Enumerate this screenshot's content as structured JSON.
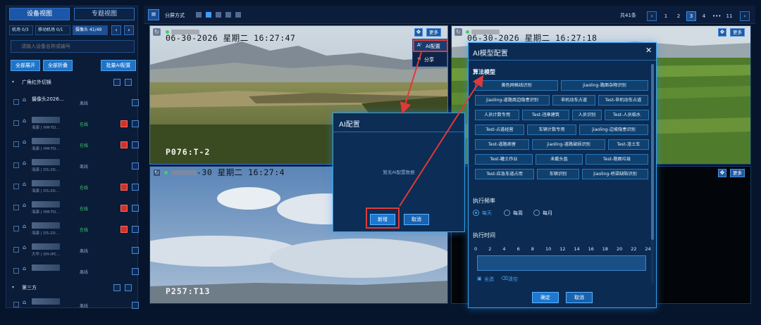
{
  "sidebar": {
    "tabs": [
      "设备视图",
      "专题视图"
    ],
    "stats": [
      "机场 0/3",
      "移动机场 0/1",
      "摄像头 41/49"
    ],
    "nav": [
      "‹",
      "›"
    ],
    "search_placeholder": "请输入设备名称或编号",
    "expand_all": "全部展开",
    "collapse_all": "全部折叠",
    "batch_ai": "批量AI配置",
    "group1": "广角红外切换",
    "group2": "第三方",
    "devices": [
      {
        "name": "摄像头2026...",
        "sub": "",
        "status": "离线",
        "online": false,
        "rec": false
      },
      {
        "name": "",
        "sub": "海康 | HM-TD...",
        "status": "在线",
        "online": true,
        "rec": true
      },
      {
        "name": "",
        "sub": "海康 | HM-TD...",
        "status": "在线",
        "online": true,
        "rec": true
      },
      {
        "name": "",
        "sub": "海康 | DS-2D...",
        "status": "离线",
        "online": false,
        "rec": false
      },
      {
        "name": "",
        "sub": "海康 | DS-2D...",
        "status": "在线",
        "online": true,
        "rec": true
      },
      {
        "name": "",
        "sub": "海康 | HM-TD...",
        "status": "在线",
        "online": true,
        "rec": true
      },
      {
        "name": "",
        "sub": "海康 | DS-2D...",
        "status": "在线",
        "online": true,
        "rec": true
      },
      {
        "name": "",
        "sub": "大华 | DH-IPC...",
        "status": "离线",
        "online": false,
        "rec": false
      },
      {
        "name": "",
        "sub": "",
        "status": "离线",
        "online": false,
        "rec": false
      }
    ],
    "device_bottom": {
      "name": "",
      "sub": "",
      "status": "离线"
    }
  },
  "topbar": {
    "split_label": "分屏方式",
    "total": "共41条",
    "pages": [
      "1",
      "2",
      "3",
      "4",
      "•••",
      "11"
    ],
    "current_page": "3"
  },
  "panes": [
    {
      "time": "06-30-2026 星期二 16:27:47",
      "name": "P076:T-2",
      "more": "更多"
    },
    {
      "time": "06-30-2026 星期二 16:27:18",
      "name": "",
      "more": "更多"
    },
    {
      "time": "-30 星期二 16:27:4",
      "name": "P257:T13",
      "more": ""
    },
    {
      "time": "",
      "name": "",
      "more": "更多"
    }
  ],
  "menu": {
    "ai": "AI配置",
    "share": "分享"
  },
  "ai_dialog": {
    "title": "AI配置",
    "empty": "暂无AI配置数据",
    "add": "新增",
    "cancel": "取消"
  },
  "model_dialog": {
    "title": "AI模型配置",
    "algo_label": "算法模型",
    "tags": [
      "黄色网格线识别",
      "jiaoling-路面杂物识别",
      "jiaoling-道路周边隐患识别",
      "非机动车占道",
      "Test-非机动车占道",
      "人员计数专用",
      "Test-违章建筑",
      "人员识别",
      "Test-人员临水",
      "Test-占道经营",
      "车辆计数专用",
      "jiaoling-边坡隐患识别",
      "Test-道路病害",
      "jiaoling-道路破损识别",
      "Test-渣土车",
      "Test-罐土作业",
      "未戴头盔",
      "Test-路面垃圾",
      "Test-应急车道占用",
      "车辆识别",
      "jiaoling-桥梁缺陷识别"
    ],
    "freq_label": "执行频率",
    "freq": [
      "每天",
      "每周",
      "每月"
    ],
    "freq_selected": "每天",
    "time_label": "执行时间",
    "hours": [
      "0",
      "2",
      "4",
      "6",
      "8",
      "10",
      "12",
      "14",
      "16",
      "18",
      "20",
      "22",
      "24"
    ],
    "select_all": "全选",
    "clear": "清空",
    "ok": "确定",
    "cancel": "取消"
  }
}
